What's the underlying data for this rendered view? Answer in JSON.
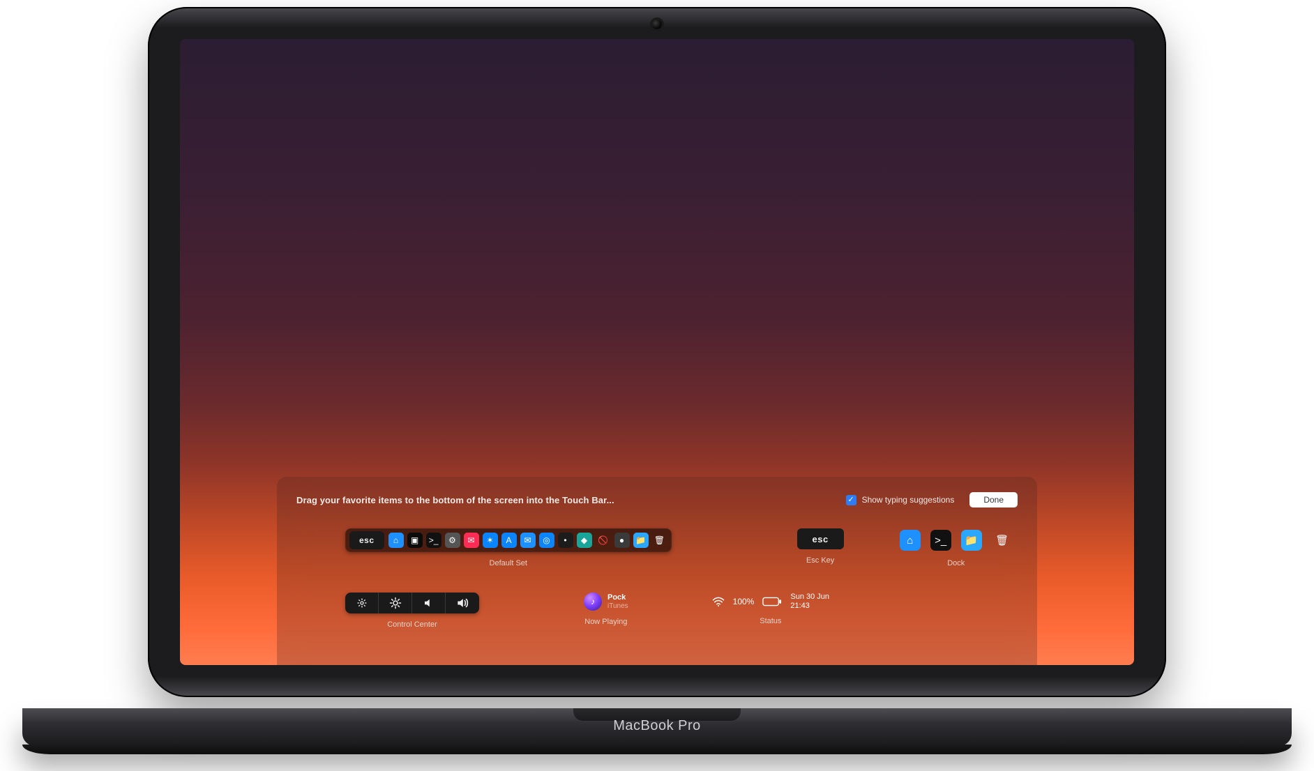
{
  "device": {
    "brand": "MacBook Pro"
  },
  "panel": {
    "title": "Drag your favorite items to the bottom of the screen into the Touch Bar...",
    "show_typing_label": "Show typing suggestions",
    "show_typing_checked": true,
    "done_label": "Done"
  },
  "defaultSet": {
    "label": "Default Set",
    "esc": "esc",
    "apps": [
      {
        "name": "finder-icon",
        "bg": "#1e90ff",
        "glyph": "⌂"
      },
      {
        "name": "dock-app-icon",
        "bg": "#0b0b0b",
        "glyph": "▣"
      },
      {
        "name": "terminal-icon",
        "bg": "#111",
        "glyph": ">_"
      },
      {
        "name": "system-prefs-icon",
        "bg": "#555",
        "glyph": "⚙"
      },
      {
        "name": "messages-icon",
        "bg": "#ff2d55",
        "glyph": "✉"
      },
      {
        "name": "safari-icon",
        "bg": "#0a84ff",
        "glyph": "✶"
      },
      {
        "name": "app-store-icon",
        "bg": "#0a84ff",
        "glyph": "A"
      },
      {
        "name": "mail-icon",
        "bg": "#1e90ff",
        "glyph": "✉"
      },
      {
        "name": "app-blue-icon",
        "bg": "#0a84ff",
        "glyph": "◎"
      },
      {
        "name": "app-dark-icon",
        "bg": "#1c1c1c",
        "glyph": "•"
      },
      {
        "name": "app-teal-icon",
        "bg": "#1aa59a",
        "glyph": "◆"
      },
      {
        "name": "blocked-icon",
        "bg": "transparent",
        "glyph": "🚫"
      },
      {
        "name": "app-gray-icon",
        "bg": "#3a3a3a",
        "glyph": "●"
      },
      {
        "name": "folder-icon",
        "bg": "#2aa8ff",
        "glyph": "📁"
      },
      {
        "name": "trash-icon",
        "bg": "transparent",
        "glyph": "🗑"
      }
    ]
  },
  "escKey": {
    "label": "Esc Key",
    "text": "esc"
  },
  "dock": {
    "label": "Dock",
    "items": [
      {
        "name": "finder-icon",
        "bg": "#1e90ff",
        "glyph": "⌂"
      },
      {
        "name": "terminal-icon",
        "bg": "#111",
        "glyph": ">_"
      },
      {
        "name": "folder-icon",
        "bg": "#2aa8ff",
        "glyph": "📁"
      },
      {
        "name": "trash-icon",
        "bg": "transparent",
        "glyph": "🗑"
      }
    ]
  },
  "controlCenter": {
    "label": "Control Center",
    "buttons": [
      "brightness-down-icon",
      "brightness-up-icon",
      "volume-down-icon",
      "volume-up-icon"
    ]
  },
  "nowPlaying": {
    "label": "Now Playing",
    "title": "Pock",
    "subtitle": "iTunes"
  },
  "status": {
    "label": "Status",
    "battery_pct": "100%",
    "date": "Sun 30 Jun",
    "time": "21:43"
  }
}
